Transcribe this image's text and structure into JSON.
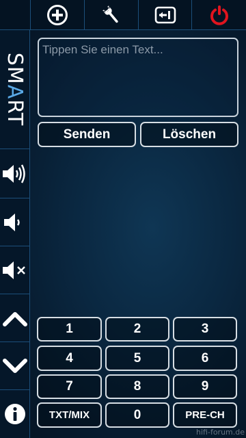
{
  "toolbar": {
    "add_icon": "plus-circle-icon",
    "settings_icon": "wrench-icon",
    "input_icon": "input-source-icon",
    "power_icon": "power-icon",
    "power_color": "#e0141e"
  },
  "sidebar": {
    "smart_label_prefix": "SM",
    "smart_label_accent": "A",
    "smart_label_suffix": "RT",
    "accent_color": "#5aa9e6",
    "items": [
      "volume-up-icon",
      "volume-down-icon",
      "mute-icon",
      "chevron-up-icon",
      "chevron-down-icon",
      "info-icon"
    ]
  },
  "text_input": {
    "placeholder": "Tippen Sie einen Text...",
    "value": ""
  },
  "actions": {
    "send_label": "Senden",
    "clear_label": "Löschen"
  },
  "keypad": {
    "k1": "1",
    "k2": "2",
    "k3": "3",
    "k4": "4",
    "k5": "5",
    "k6": "6",
    "k7": "7",
    "k8": "8",
    "k9": "9",
    "txt_mix": "TXT/MIX",
    "k0": "0",
    "pre_ch": "PRE-CH"
  },
  "watermark": "hifi-forum.de"
}
